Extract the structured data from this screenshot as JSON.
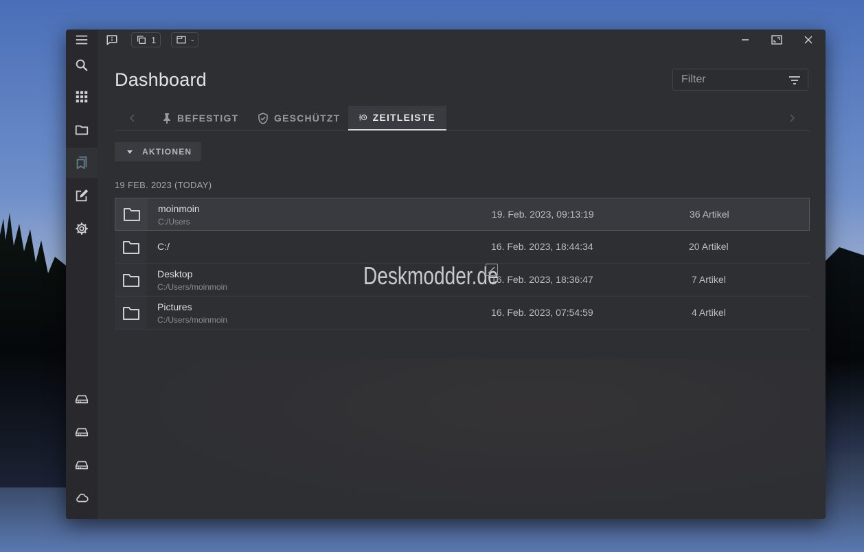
{
  "window": {
    "titlebar": {
      "copy_count": "1",
      "panes_value": "-"
    },
    "title": "Dashboard",
    "filter": {
      "placeholder": "Filter"
    },
    "tabs": [
      {
        "label": "BEFESTIGT",
        "icon": "pin-icon",
        "active": false
      },
      {
        "label": "GESCHÜTZT",
        "icon": "shield-check-icon",
        "active": false
      },
      {
        "label": "ZEITLEISTE",
        "icon": "timeline-history-icon",
        "active": true
      }
    ],
    "actions_label": "AKTIONEN",
    "date_heading": "19 FEB. 2023 (TODAY)",
    "rows": [
      {
        "name": "moinmoin",
        "path": "C:/Users",
        "date": "19. Feb. 2023, 09:13:19",
        "count": "36 Artikel",
        "selected": true
      },
      {
        "name": "C:/",
        "path": "",
        "date": "16. Feb. 2023, 18:44:34",
        "count": "20 Artikel",
        "selected": false
      },
      {
        "name": "Desktop",
        "path": "C:/Users/moinmoin",
        "date": "16. Feb. 2023, 18:36:47",
        "count": "7 Artikel",
        "selected": false
      },
      {
        "name": "Pictures",
        "path": "C:/Users/moinmoin",
        "date": "16. Feb. 2023, 07:54:59",
        "count": "4 Artikel",
        "selected": false
      }
    ],
    "watermark": "Deskmodder.de"
  },
  "sidebar": {
    "top": [
      "menu-icon",
      "search-icon",
      "apps-grid-icon",
      "folder-icon",
      "bookmarks-icon",
      "edit-note-icon",
      "settings-gear-icon"
    ],
    "active": "bookmarks-icon",
    "bottom": [
      "drive-icon",
      "drive-icon",
      "drive-icon",
      "cloud-icon"
    ]
  },
  "colors": {
    "window_bg": "#2e2f33",
    "rail_bg": "#29292d",
    "active_tab_bg": "#3a3b40",
    "selected_row_bg": "#393a40",
    "accent_active_icon": "#5f7f8a"
  }
}
